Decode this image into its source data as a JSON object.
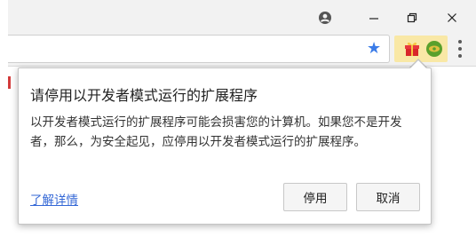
{
  "window": {
    "controls": [
      "account-icon",
      "minimize-icon",
      "restore-icon",
      "close-icon"
    ]
  },
  "toolbar": {
    "bookmark_icon": "star-icon",
    "bookmark_color": "#3b7ce8",
    "extensions": [
      "gift-extension-icon",
      "green-circle-extension-icon"
    ],
    "extension_highlight_color": "#f9e8a6",
    "menu_icon": "vertical-dots-menu-icon"
  },
  "popup": {
    "title": "请停用以开发者模式运行的扩展程序",
    "body": "以开发者模式运行的扩展程序可能会损害您的计算机。如果您不是开发者，那么，为安全起见，应停用以开发者模式运行的扩展程序。",
    "learn_more": "了解详情",
    "disable_button": "停用",
    "cancel_button": "取消",
    "link_color": "#3367d6"
  }
}
